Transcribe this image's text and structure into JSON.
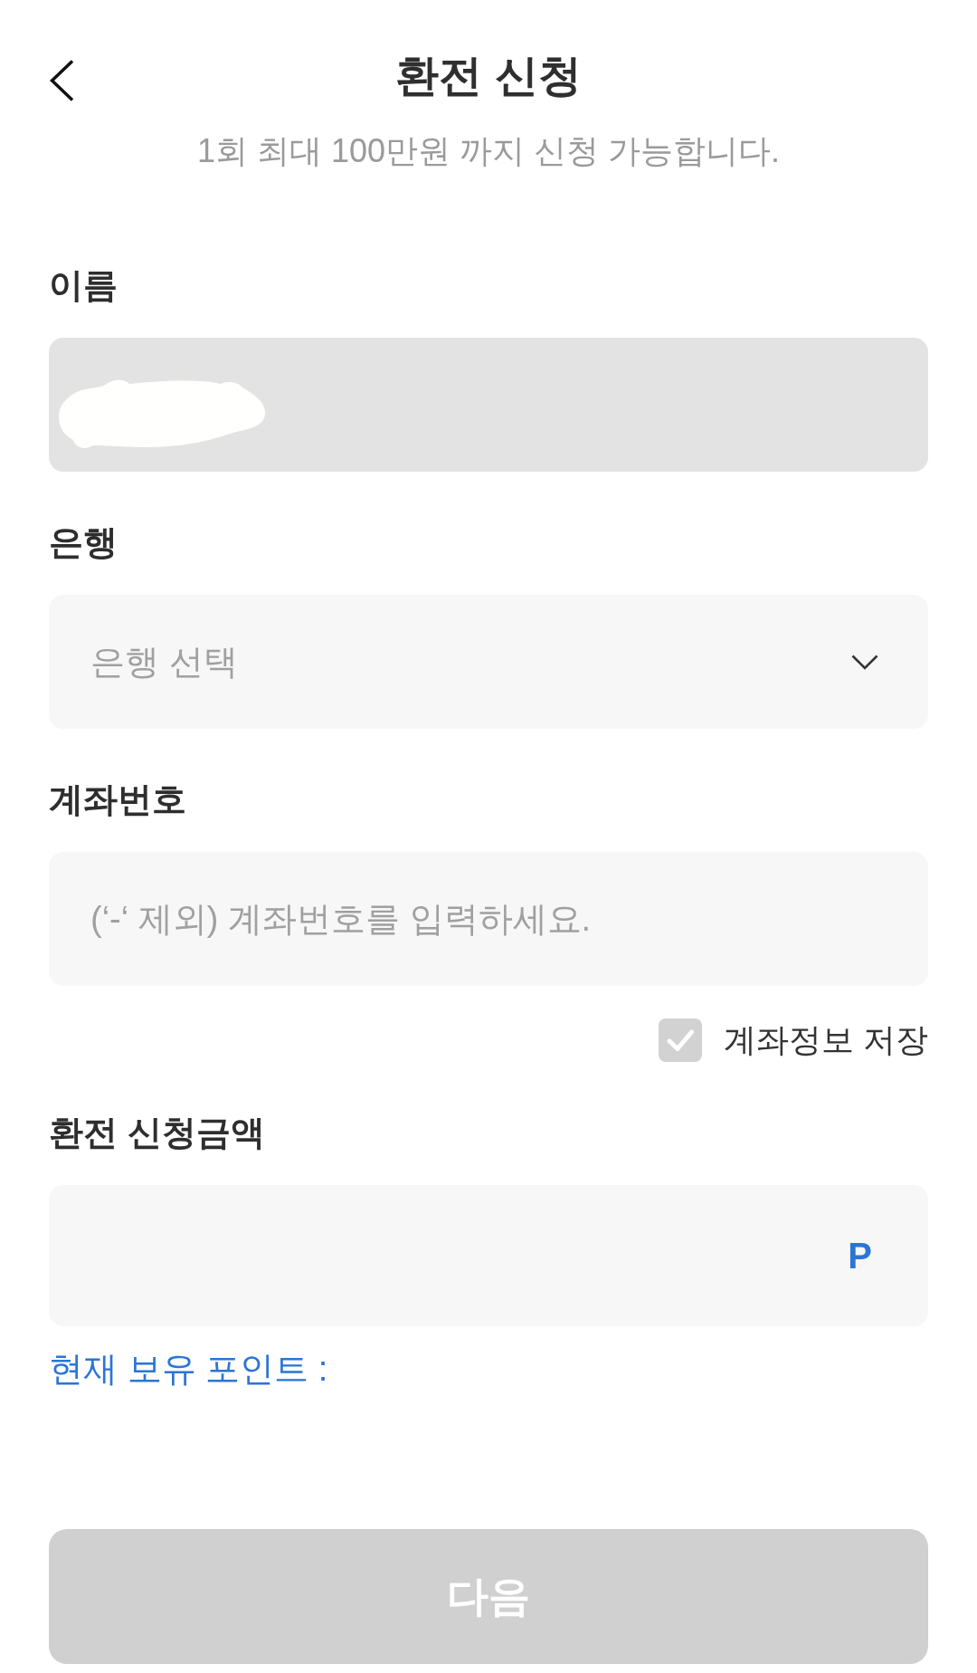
{
  "header": {
    "title": "환전 신청",
    "subtitle": "1회 최대 100만원 까지 신청 가능합니다."
  },
  "fields": [
    {
      "kind": "text",
      "label": "이름",
      "disabled": true,
      "redacted": true
    },
    {
      "kind": "select",
      "label": "은행",
      "placeholder": "은행 선택",
      "disabled": false
    },
    {
      "kind": "text",
      "label": "계좌번호",
      "placeholder": "(‘-‘ 제외) 계좌번호를 입력하세요.",
      "disabled": false,
      "save_option": {
        "label": "계좌정보 저장",
        "checked": false
      }
    },
    {
      "kind": "amount",
      "label": "환전 신청금액",
      "unit": "P",
      "note": "현재 보유 포인트 :",
      "disabled": false
    }
  ],
  "next_button": {
    "label": "다음",
    "disabled": true
  }
}
